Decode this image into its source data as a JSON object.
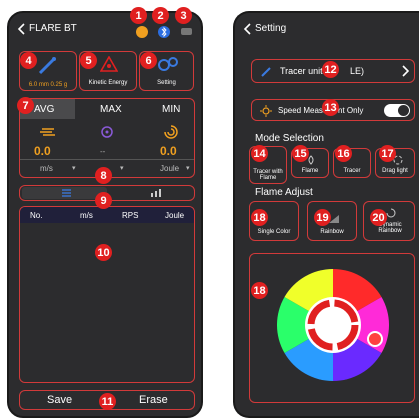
{
  "phone1": {
    "title": "FLARE BT",
    "top_cards": [
      {
        "label": "6.0 mm  0.25 g",
        "icon": "tracer-unit-icon"
      },
      {
        "label": "Kinetic Energy",
        "icon": "warning-triangle-icon"
      },
      {
        "label": "Setting",
        "icon": "gears-icon"
      }
    ],
    "tabs": [
      "AVG",
      "MAX",
      "MIN"
    ],
    "values": [
      "0.0",
      "--",
      "0.0"
    ],
    "units": [
      "m/s",
      "",
      "Joule"
    ],
    "table_headers": [
      "No.",
      "m/s",
      "RPS",
      "Joule"
    ],
    "save_label": "Save",
    "erase_label": "Erase"
  },
  "phone2": {
    "title": "Setting",
    "tracer_unit_label": "Tracer unit (",
    "tracer_unit_suffix": "LE)",
    "speed_only_label": "Speed Measu",
    "speed_only_suffix": "nt Only",
    "mode_section": "Mode Selection",
    "modes": [
      "Tracer with Flame",
      "Flame",
      "Tracer",
      "Drag light"
    ],
    "flame_section": "Flame Adjust",
    "flames": [
      "Single Color",
      "Rainbow",
      "Dynamic Rainbow"
    ]
  },
  "badges": [
    "1",
    "2",
    "3",
    "4",
    "5",
    "6",
    "7",
    "8",
    "9",
    "10",
    "11",
    "12",
    "13",
    "14",
    "15",
    "16",
    "17",
    "18",
    "19",
    "20",
    "18"
  ],
  "colors": {
    "accent": "#e02020",
    "value": "#f0a020",
    "bg": "#2c2c2e"
  }
}
